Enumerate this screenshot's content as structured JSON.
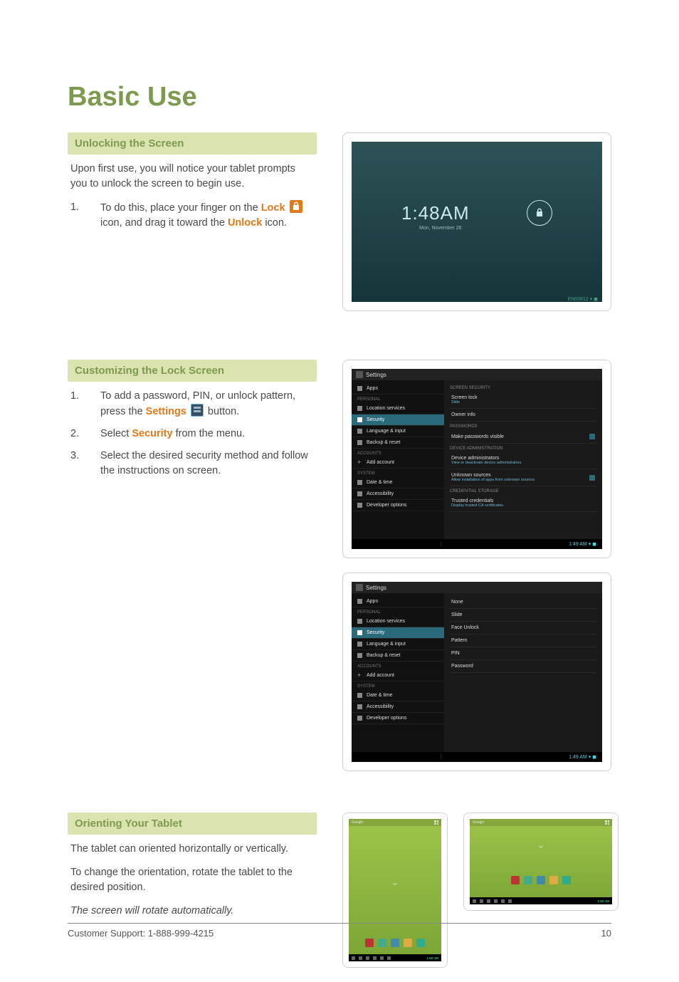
{
  "page_title": "Basic Use",
  "sections": {
    "unlock": {
      "header": "Unlocking the Screen",
      "intro": "Upon first use, you will notice your tablet prompts you to unlock the screen to begin use.",
      "step1_a": "To do this,  place your finger on the ",
      "step1_lock": "Lock",
      "step1_b": "  icon, and drag it toward the ",
      "step1_unlock": "Unlock",
      "step1_c": " icon."
    },
    "customize": {
      "header": "Customizing the Lock Screen",
      "step1_a": "To add a password, PIN, or unlock pattern, press the ",
      "step1_settings": "Settings",
      "step1_b": "  button.",
      "step2_a": "Select ",
      "step2_security": "Security",
      "step2_b": " from the menu.",
      "step3": "Select the desired security method and follow the instructions on screen."
    },
    "orient": {
      "header": "Orienting Your Tablet",
      "p1": "The tablet can oriented horizontally or vertically.",
      "p2": "To change the orientation, rotate the tablet to the desired position.",
      "p3": "The screen will rotate automatically."
    }
  },
  "lockscreen": {
    "time": "1:48AM",
    "date": "Mon, November 26",
    "status": "EN00812"
  },
  "settings1": {
    "title": "Settings",
    "side": {
      "apps": "Apps",
      "personal": "PERSONAL",
      "location": "Location services",
      "security": "Security",
      "language": "Language & input",
      "backup": "Backup & reset",
      "accounts": "ACCOUNTS",
      "add_account": "Add account",
      "system": "SYSTEM",
      "datetime": "Date & time",
      "accessibility": "Accessibility",
      "developer": "Developer options"
    },
    "main": {
      "h1": "SCREEN SECURITY",
      "screen_lock": "Screen lock",
      "screen_lock_sub": "Slide",
      "owner": "Owner info",
      "h2": "PASSWORDS",
      "visible": "Make passwords visible",
      "h3": "DEVICE ADMINISTRATION",
      "admins": "Device administrators",
      "admins_sub": "View or deactivate device administrators",
      "unknown": "Unknown sources",
      "unknown_sub": "Allow installation of apps from unknown sources",
      "h4": "CREDENTIAL STORAGE",
      "trusted": "Trusted credentials",
      "trusted_sub": "Display trusted CA certificates"
    },
    "navtime": "1:49 AM"
  },
  "settings2": {
    "title": "Settings",
    "options": {
      "none": "None",
      "slide": "Slide",
      "face": "Face Unlock",
      "pattern": "Pattern",
      "pin": "PIN",
      "password": "Password"
    },
    "navtime": "1:49 AM"
  },
  "home": {
    "search": "Google",
    "navtime_p": "1:50 AM",
    "navtime_l": "1:50 AM",
    "dock_colors": [
      "#b33",
      "#4a8",
      "#48a",
      "#da4",
      "#3a8"
    ]
  },
  "footer": {
    "support": "Customer Support: 1-888-999-4215",
    "page": "10"
  }
}
